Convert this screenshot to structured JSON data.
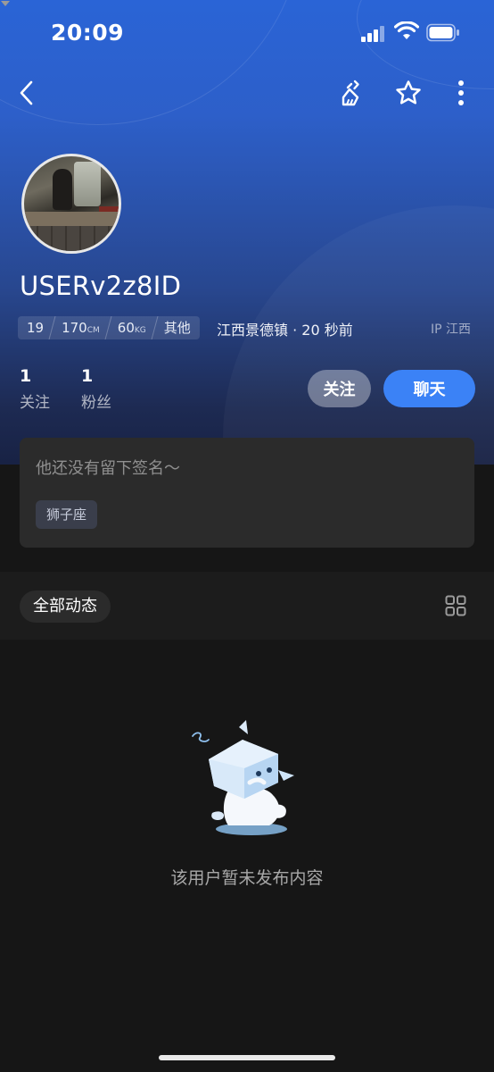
{
  "status_bar": {
    "time": "20:09"
  },
  "nav": {
    "back_icon": "chevron-left-icon",
    "clean_icon": "broom-icon",
    "favorite_icon": "star-icon",
    "more_icon": "more-vertical-icon"
  },
  "profile": {
    "username": "USERv2z8ID",
    "tags": [
      {
        "value": "19",
        "unit": ""
      },
      {
        "value": "170",
        "unit": "CM"
      },
      {
        "value": "60",
        "unit": "KG"
      },
      {
        "value": "其他",
        "unit": ""
      }
    ],
    "location": "江西景德镇 · 20 秒前",
    "ip": "IP 江西",
    "following_count": "1",
    "following_label": "关注",
    "followers_count": "1",
    "followers_label": "粉丝",
    "follow_button": "关注",
    "chat_button": "聊天"
  },
  "signature_card": {
    "signature": "他还没有留下签名～",
    "zodiac": "狮子座"
  },
  "feed": {
    "tab_label": "全部动态",
    "empty_text": "该用户暂未发布内容"
  },
  "colors": {
    "accent": "#3b82f6",
    "hero_top": "#2a64d6",
    "background": "#161616",
    "card": "#2b2b2b"
  }
}
